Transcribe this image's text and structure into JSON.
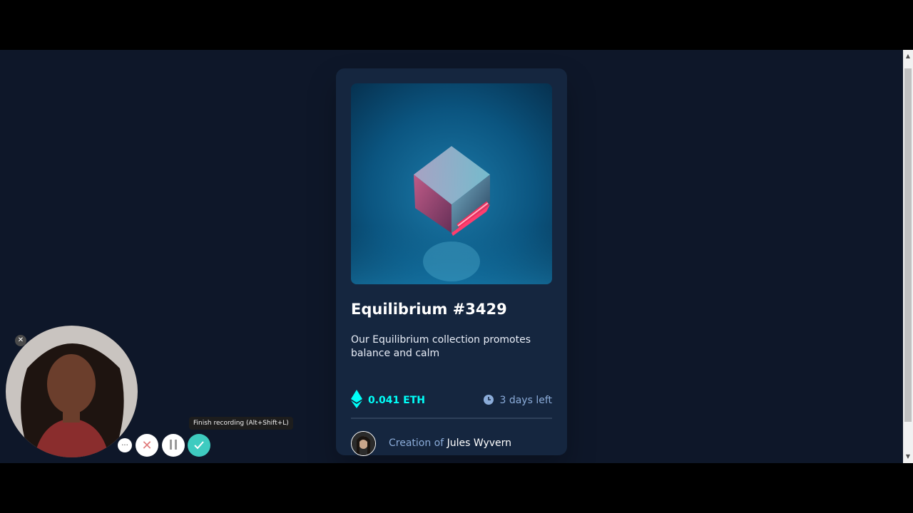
{
  "card": {
    "title": "Equilibrium #3429",
    "description": "Our Equilibrium collection promotes balance and calm",
    "price": "0.041 ETH",
    "time_left": "3 days left",
    "creator_prefix": "Creation of",
    "creator_name": "Jules Wyvern"
  },
  "recorder": {
    "tooltip": "Finish recording (Alt+Shift+L)",
    "more_label": "···",
    "cancel_label": "✕"
  },
  "colors": {
    "page_bg": "#0e1729",
    "card_bg": "#15263f",
    "cyan": "#00fff8",
    "soft_blue": "#8bacd9",
    "finish_teal": "#3ecbc0"
  },
  "icons": [
    "ethereum-icon",
    "clock-icon",
    "close-icon",
    "more-icon",
    "pause-icon",
    "check-icon"
  ]
}
